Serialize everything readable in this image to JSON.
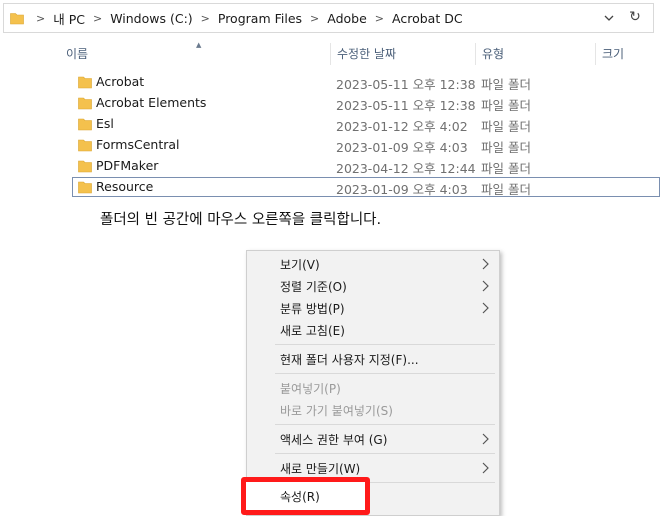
{
  "address_bar": {
    "segments": [
      "내 PC",
      "Windows (C:)",
      "Program Files",
      "Adobe",
      "Acrobat DC"
    ]
  },
  "columns": {
    "name": "이름",
    "date": "수정한 날짜",
    "type": "유형",
    "size": "크기"
  },
  "files": [
    {
      "name": "Acrobat",
      "date": "2023-05-11 오후 12:38",
      "type": "파일 폴더"
    },
    {
      "name": "Acrobat Elements",
      "date": "2023-05-11 오후 12:38",
      "type": "파일 폴더"
    },
    {
      "name": "Esl",
      "date": "2023-01-12 오후 4:02",
      "type": "파일 폴더"
    },
    {
      "name": "FormsCentral",
      "date": "2023-01-09 오후 4:03",
      "type": "파일 폴더"
    },
    {
      "name": "PDFMaker",
      "date": "2023-04-12 오후 12:44",
      "type": "파일 폴더"
    },
    {
      "name": "Resource",
      "date": "2023-01-09 오후 4:03",
      "type": "파일 폴더"
    }
  ],
  "caption": "폴더의 빈 공간에 마우스 오른쪽을 클릭합니다.",
  "context_menu": {
    "view": "보기(V)",
    "sort_by": "정렬 기준(O)",
    "group_by": "분류 방법(P)",
    "refresh": "새로 고침(E)",
    "customize": "현재 폴더 사용자 지정(F)...",
    "paste": "붙여넣기(P)",
    "paste_shortcut": "바로 가기 붙여넣기(S)",
    "give_access": "액세스 권한 부여 (G)",
    "new": "새로 만들기(W)",
    "properties": "속성(R)"
  },
  "colors": {
    "folder": "#f4c14d",
    "highlight": "#ff1a1a",
    "header_text": "#4c607a"
  }
}
